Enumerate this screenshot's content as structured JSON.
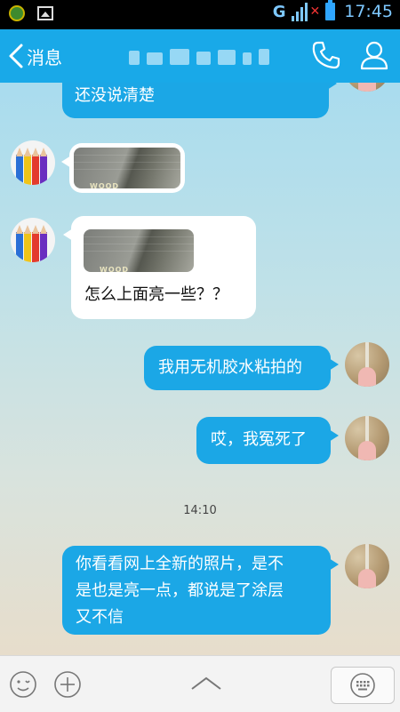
{
  "status_bar": {
    "network": "G",
    "time": "17:45"
  },
  "header": {
    "back_label": "消息",
    "icons": [
      "chevron-left-icon",
      "phone-icon",
      "profile-icon"
    ]
  },
  "messages": [
    {
      "from": "me",
      "type": "text",
      "text": "还没说清楚"
    },
    {
      "from": "other",
      "type": "image",
      "image_text": "WOOD"
    },
    {
      "from": "other",
      "type": "image_text",
      "image_text": "WOOD",
      "text": "怎么上面亮一些？？"
    },
    {
      "from": "me",
      "type": "text",
      "text": "我用无机胶水粘拍的"
    },
    {
      "from": "me",
      "type": "text",
      "text": "哎，我冤死了"
    },
    {
      "from": "system",
      "type": "time",
      "text": "14:10"
    },
    {
      "from": "me",
      "type": "text",
      "lines": [
        "你看看网上全新的照片，是不",
        "是也是亮一点，都说是了涂层",
        "又不信"
      ]
    }
  ],
  "input_bar": {
    "icons": [
      "emoji-icon",
      "plus-icon",
      "chevron-up-icon",
      "keyboard-icon"
    ]
  },
  "colors": {
    "title_bar": "#19a9e8",
    "outgoing_bubble": "#1ba7e6",
    "incoming_bubble": "#ffffff"
  }
}
